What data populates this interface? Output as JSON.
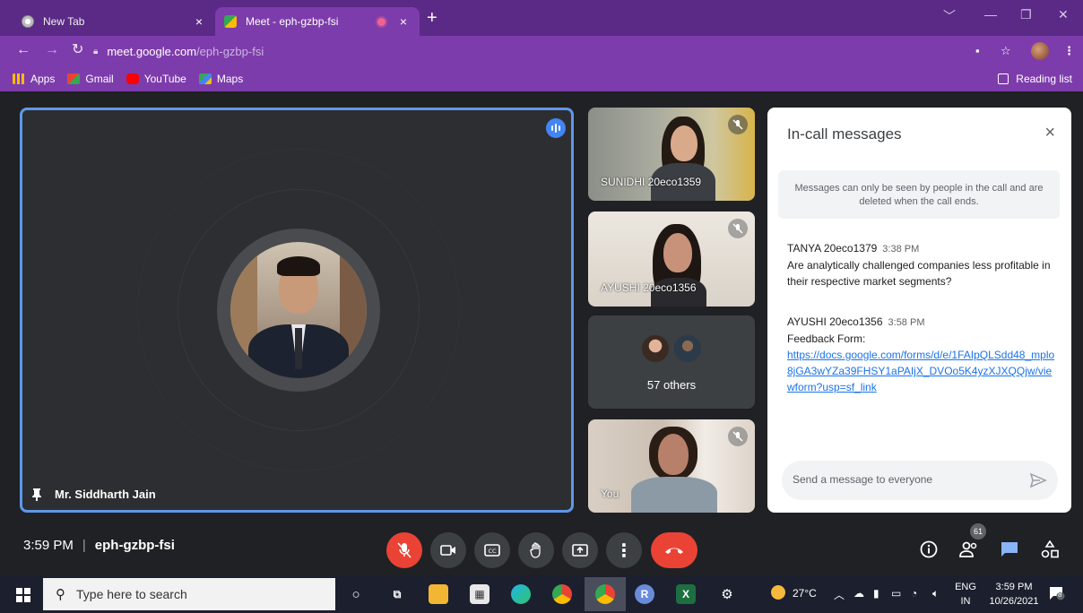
{
  "browser": {
    "tabs": [
      {
        "title": "New Tab",
        "close": "×",
        "active": false
      },
      {
        "title": "Meet - eph-gzbp-fsi",
        "close": "×",
        "active": true
      }
    ],
    "new_tab": "+",
    "url_host": "meet.google.com",
    "url_path": "/eph-gzbp-fsi",
    "bookmarks": [
      {
        "label": "Apps",
        "icon": "apps-grid-icon",
        "color": "#fbbc04"
      },
      {
        "label": "Gmail",
        "icon": "gmail-icon",
        "color": "#ea4335"
      },
      {
        "label": "YouTube",
        "icon": "youtube-icon",
        "color": "#ff0000"
      },
      {
        "label": "Maps",
        "icon": "maps-icon",
        "color": "#34a853"
      }
    ],
    "reading_list": "Reading list"
  },
  "main_participant": {
    "name": "Mr. Siddharth Jain",
    "highlight_color": "#5e97e8"
  },
  "side_tiles": [
    {
      "name": "SUNIDHI 20eco1359"
    },
    {
      "name": "AYUSHI 20eco1356"
    },
    {
      "others": "57 others"
    },
    {
      "name": "You"
    }
  ],
  "chat": {
    "title": "In-call messages",
    "close": "×",
    "note": "Messages can only be seen by people in the call and are deleted when the call ends.",
    "messages": [
      {
        "sender": "TANYA 20eco1379",
        "time": "3:38 PM",
        "text": "Are analytically challenged companies less profitable in their respective market segments?"
      },
      {
        "sender": "AYUSHI 20eco1356",
        "time": "3:58 PM",
        "text": "Feedback Form:",
        "link": "https://docs.google.com/forms/d/e/1FAIpQLSdd48_mplo8jGA3wYZa39FHSY1aPAIjX_DVOo5K4yzXJXQQjw/viewform?usp=sf_link"
      }
    ],
    "input_placeholder": "Send a message to everyone"
  },
  "meeting_bar": {
    "time": "3:59 PM",
    "separator": "|",
    "code": "eph-gzbp-fsi",
    "participants_badge": "61"
  },
  "taskbar": {
    "search_placeholder": "Type here to search",
    "weather": "27°C",
    "lang_top": "ENG",
    "lang_bottom": "IN",
    "clock_time": "3:59 PM",
    "clock_date": "10/26/2021",
    "notifications": "8"
  }
}
